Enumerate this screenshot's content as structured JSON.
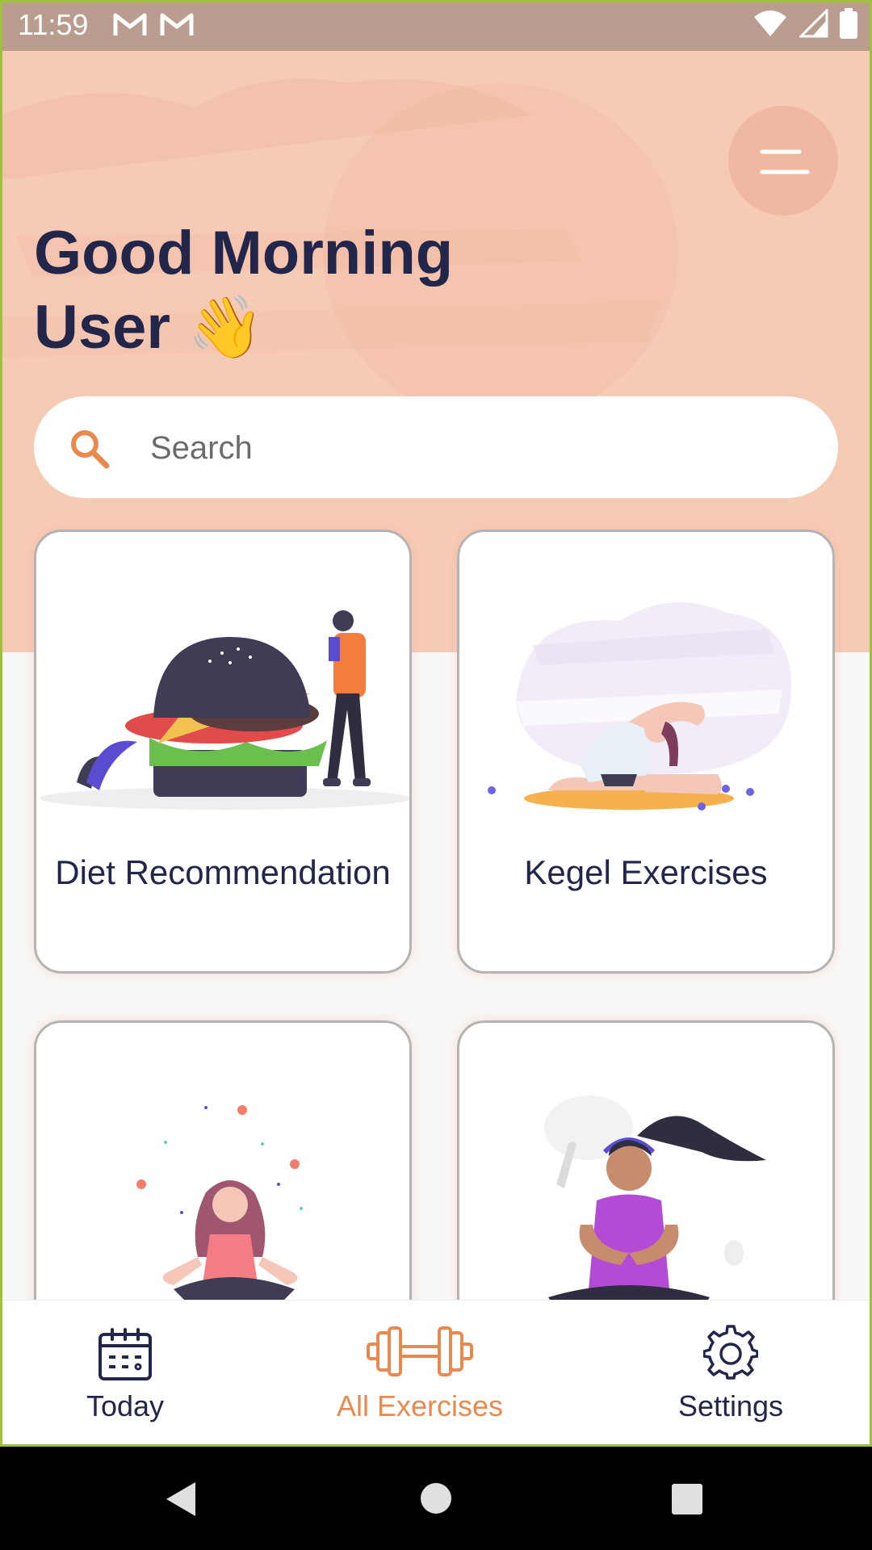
{
  "status": {
    "time": "11:59"
  },
  "header": {
    "greeting_line1": "Good Morning",
    "greeting_line2": "User 👋"
  },
  "search": {
    "placeholder": "Search"
  },
  "cards": [
    {
      "label": "Diet Recommendation"
    },
    {
      "label": "Kegel Exercises"
    },
    {
      "label": ""
    },
    {
      "label": ""
    }
  ],
  "nav": [
    {
      "label": "Today",
      "icon": "calendar-icon"
    },
    {
      "label": "All Exercises",
      "icon": "dumbbell-icon",
      "active": true
    },
    {
      "label": "Settings",
      "icon": "gear-icon"
    }
  ],
  "colors": {
    "accent": "#e8894f",
    "hero_bg": "#f6cbb6",
    "text_dark": "#22264a",
    "status_bar": "#bb9d90"
  }
}
